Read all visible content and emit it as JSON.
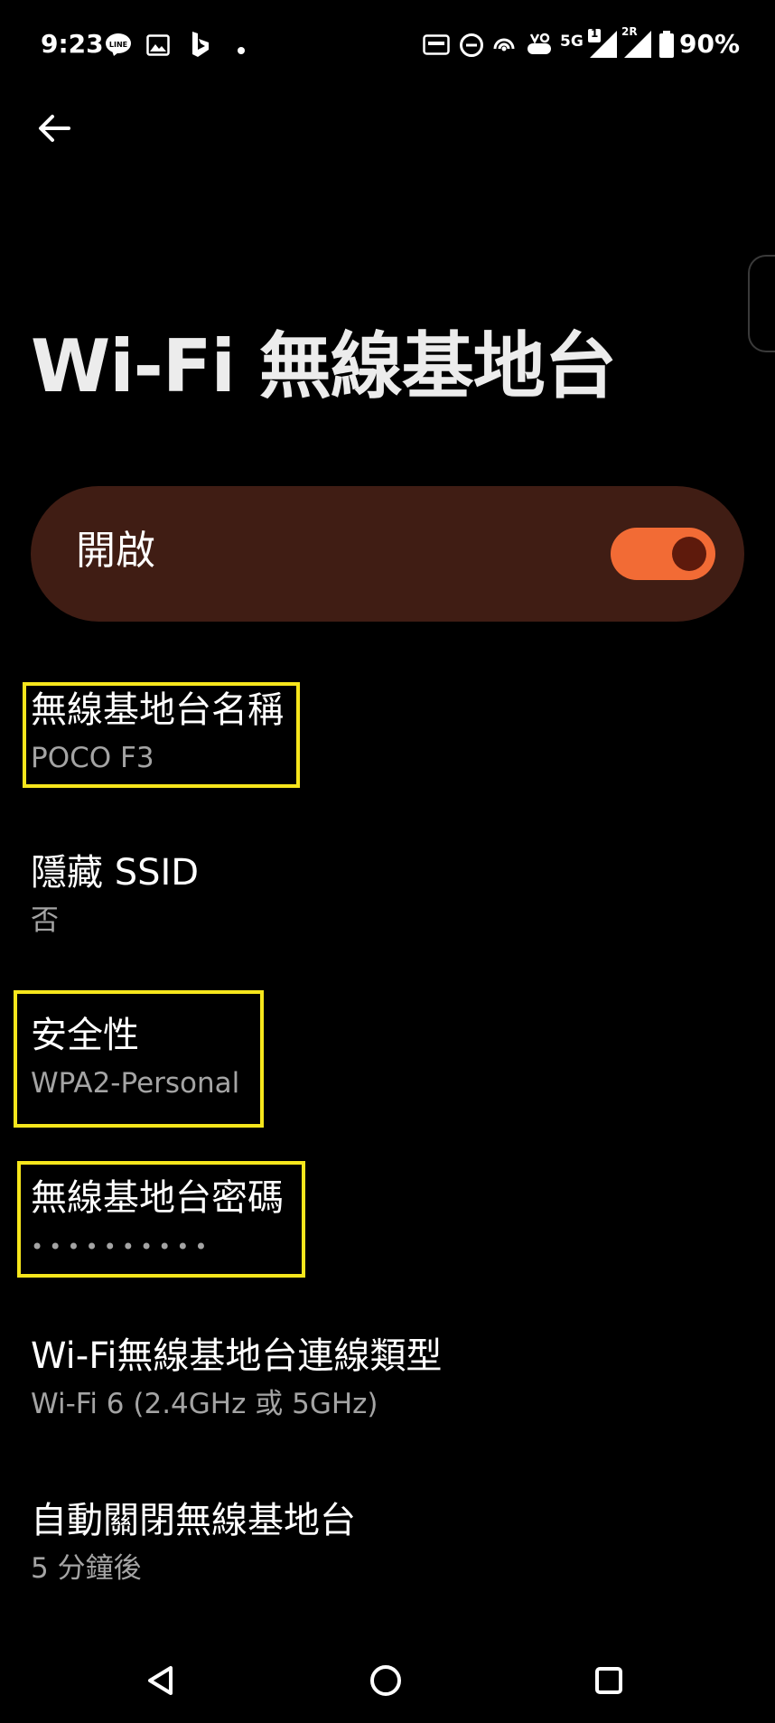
{
  "status_bar": {
    "time": "9:23",
    "notification_icons": [
      "line-icon",
      "gallery-icon",
      "bing-icon",
      "more-dot-icon"
    ],
    "system_icons": [
      "auto-hz-icon",
      "dnd-icon",
      "hotspot-icon",
      "volte-icon",
      "signal-1-icon",
      "signal-2r-icon",
      "battery-icon"
    ],
    "line_label": "LINE",
    "network_label": "5G",
    "sim1_label": "1",
    "sim2_label": "2R",
    "battery": "90%"
  },
  "header": {
    "back_icon": "arrow-left-icon",
    "title": "Wi-Fi 無線基地台"
  },
  "master_toggle": {
    "label": "開啟",
    "state": "on",
    "track_color": "#f26b35",
    "card_color": "#401d14"
  },
  "settings": [
    {
      "title": "無線基地台名稱",
      "value": "POCO F3",
      "highlighted": true
    },
    {
      "title": "隱藏 SSID",
      "value": "否",
      "highlighted": false
    },
    {
      "title": "安全性",
      "value": "WPA2-Personal",
      "highlighted": true
    },
    {
      "title": "無線基地台密碼",
      "value": "••••••••••",
      "highlighted": true
    },
    {
      "title": "Wi-Fi無線基地台連線類型",
      "value": "Wi-Fi 6 (2.4GHz 或 5GHz)",
      "highlighted": false
    },
    {
      "title": "自動關閉無線基地台",
      "value": "5 分鐘後",
      "highlighted": false
    }
  ],
  "highlight_color": "#f6e61c",
  "nav_bar": {
    "icons": [
      "nav-back-icon",
      "nav-home-icon",
      "nav-recents-icon"
    ]
  }
}
